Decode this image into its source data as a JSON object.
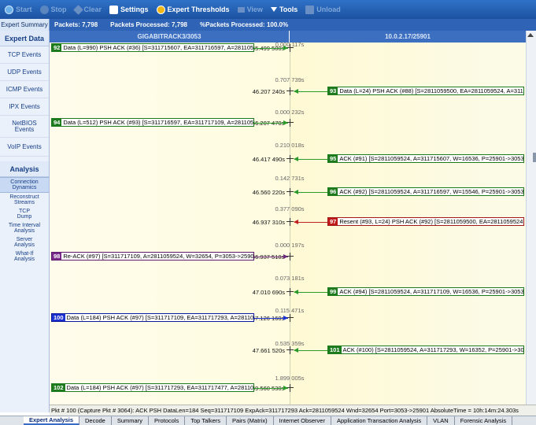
{
  "toolbar": {
    "start": "Start",
    "stop": "Stop",
    "clear": "Clear",
    "settings": "Settings",
    "expert_thresholds": "Expert Thresholds",
    "view": "View",
    "tools": "Tools",
    "unload": "Unload"
  },
  "status": {
    "expert_summary": "Expert Summary",
    "packets": "Packets: 7,798",
    "packets_processed": "Packets Processed: 7,798",
    "pct_processed": "%Packets Processed: 100.0%"
  },
  "columns": {
    "left": "GIGABITRACK3/3053",
    "right": "10.0.2.17/25901"
  },
  "sidebar": {
    "expert_data_title": "Expert Data",
    "events": [
      {
        "label": "TCP Events"
      },
      {
        "label": "UDP Events"
      },
      {
        "label": "ICMP Events"
      },
      {
        "label": "IPX Events"
      },
      {
        "label": "NetBIOS Events"
      },
      {
        "label": "VoIP Events"
      }
    ],
    "analysis_title": "Analysis",
    "analysis": [
      {
        "label": "Connection Dynamics"
      },
      {
        "label": "Reconstruct Streams"
      },
      {
        "label": "TCP Dump"
      },
      {
        "label": "Time Interval Analysis"
      },
      {
        "label": "Server Analysis"
      },
      {
        "label": "What-If Analysis"
      }
    ]
  },
  "flow": {
    "timestamps": [
      {
        "text": "45.499 500s"
      },
      {
        "text": "46.207 240s"
      },
      {
        "text": "46.207 470s"
      },
      {
        "text": "46.417 490s"
      },
      {
        "text": "46.560 220s"
      },
      {
        "text": "46.937 310s"
      },
      {
        "text": "46.937 510s"
      },
      {
        "text": "47.010 690s"
      },
      {
        "text": "47.126 160s"
      },
      {
        "text": "47.661 520s"
      },
      {
        "text": "49.560 530s"
      }
    ],
    "deltas": [
      {
        "text": "0.000 117s"
      },
      {
        "text": "0.707 739s"
      },
      {
        "text": "0.000 232s"
      },
      {
        "text": "0.210 018s"
      },
      {
        "text": "0.142 731s"
      },
      {
        "text": "0.377 090s"
      },
      {
        "text": "0.000 197s"
      },
      {
        "text": "0.073 181s"
      },
      {
        "text": "0.115 471s"
      },
      {
        "text": "0.535 359s"
      },
      {
        "text": "1.899 005s"
      }
    ],
    "packets": [
      {
        "num": "92",
        "text": "Data (L=990) PSH ACK (#36) [S=311715607, EA=311716597, A=2811059500...",
        "dir": "left",
        "color": "green"
      },
      {
        "num": "93",
        "text": "Data (L=24) PSH ACK (#88) [S=2811059500, EA=2811059524, A=311714253...",
        "dir": "right",
        "color": "green"
      },
      {
        "num": "94",
        "text": "Data (L=512) PSH ACK (#93) [S=311716597, EA=311717109, A=2811059500...",
        "dir": "left",
        "color": "green"
      },
      {
        "num": "95",
        "text": "ACK (#91) [S=2811059524, A=311715607, W=16536, P=25901->3053]",
        "dir": "right",
        "color": "green"
      },
      {
        "num": "96",
        "text": "ACK (#92) [S=2811059524, A=311716597, W=15546, P=25901->3053]",
        "dir": "right",
        "color": "green"
      },
      {
        "num": "97",
        "text": "Resent (#93, L=24) PSH ACK (#92) [S=2811059500, EA=2811059524, A=3117...",
        "dir": "right",
        "color": "red"
      },
      {
        "num": "98",
        "text": "Re-ACK (#97) [S=311717109, A=2811059524, W=32654, P=3053->25901]",
        "dir": "left",
        "color": "purple"
      },
      {
        "num": "99",
        "text": "ACK (#94) [S=2811059524, A=311717109, W=16536, P=25901->3053]",
        "dir": "right",
        "color": "green"
      },
      {
        "num": "100",
        "text": "Data (L=184) PSH ACK (#97) [S=311717109, EA=311717293, A=2811059524...",
        "dir": "left",
        "color": "blue"
      },
      {
        "num": "101",
        "text": "ACK (#100) [S=2811059524, A=311717293, W=16352, P=25901->3053]",
        "dir": "right",
        "color": "green"
      },
      {
        "num": "102",
        "text": "Data (L=184) PSH ACK (#97) [S=311717293, EA=311717477, A=2811059524...",
        "dir": "left",
        "color": "green"
      }
    ]
  },
  "detail": "Pkt # 100 (Capture Pkt # 3064):  ACK  PSH  DataLen=184  Seq=311717109  ExpAck=311717293  Ack=2811059524  Wnd=32654  Port=3053->25901  AbsoluteTime = 10h:14m:24.303s",
  "tabs": [
    {
      "label": "Expert Analysis"
    },
    {
      "label": "Decode"
    },
    {
      "label": "Summary"
    },
    {
      "label": "Protocols"
    },
    {
      "label": "Top Talkers"
    },
    {
      "label": "Pairs (Matrix)"
    },
    {
      "label": "Internet Observer"
    },
    {
      "label": "Application Transaction Analysis"
    },
    {
      "label": "VLAN"
    },
    {
      "label": "Forensic Analysis"
    }
  ]
}
